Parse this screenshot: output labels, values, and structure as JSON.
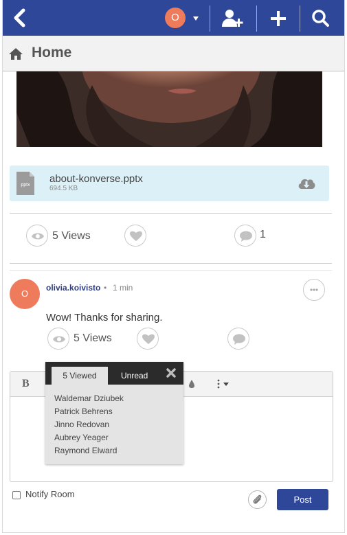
{
  "topbar": {
    "back_icon": "chevron-left-icon",
    "user_initial": "O",
    "avatar_color": "#ef7b5d",
    "accent": "#2f4799",
    "icons": [
      "add-user-icon",
      "plus-icon",
      "search-icon"
    ]
  },
  "home": {
    "icon": "home-icon",
    "title": "Home"
  },
  "attachment": {
    "file_type_label": "pptx",
    "name": "about-konverse.pptx",
    "size": "694.5 KB",
    "icon": "cloud-download-icon"
  },
  "post_stats": {
    "views": "5 Views",
    "comments": "1"
  },
  "comment": {
    "initial": "O",
    "author": "olivia.koivisto",
    "separator": "•",
    "time": "1 min",
    "text": "Wow! Thanks for sharing.",
    "views": "5 Views"
  },
  "editor": {
    "bold_label": "B"
  },
  "popover": {
    "tab_viewed": "5  Viewed",
    "tab_unread": "Unread",
    "viewers": [
      "Waldemar Dziubek",
      "Patrick Behrens",
      "Jinno Redovan",
      "Aubrey Yeager",
      "Raymond Elward"
    ]
  },
  "footer": {
    "notify_label": "Notify Room",
    "post_label": "Post"
  }
}
